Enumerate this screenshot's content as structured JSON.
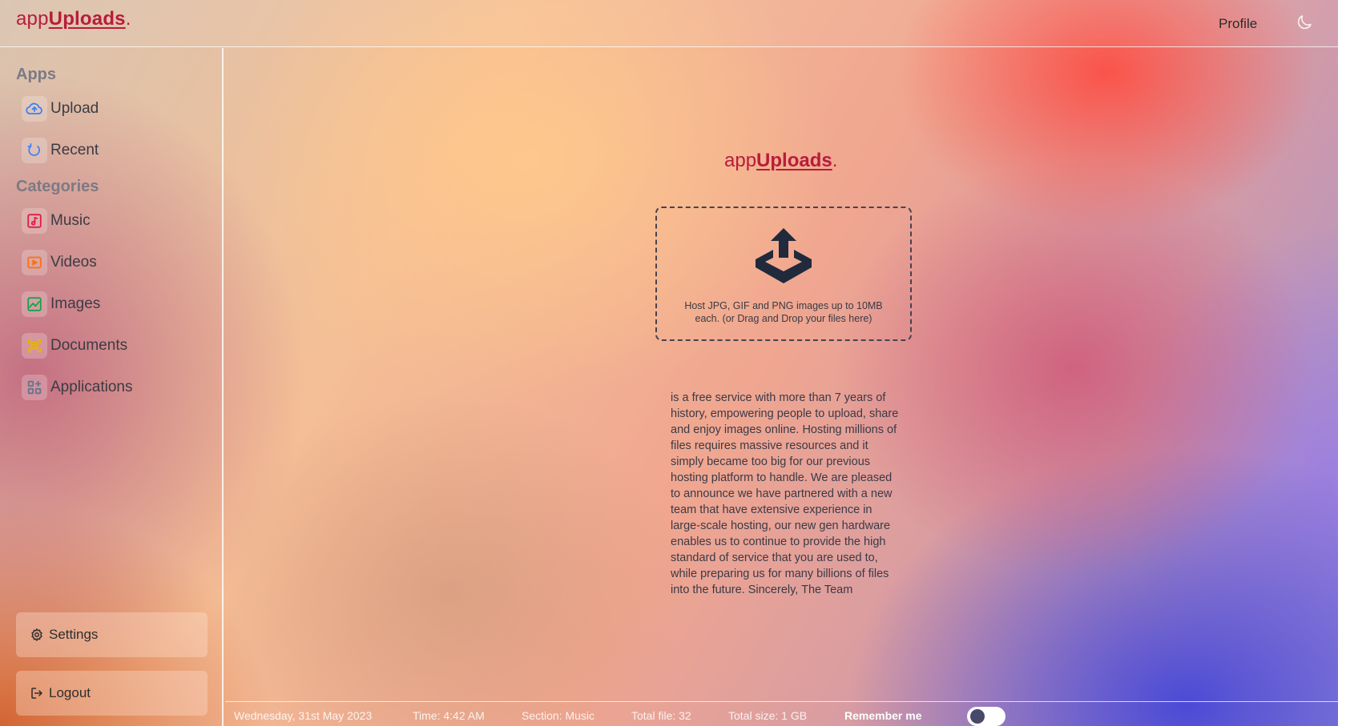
{
  "header": {
    "logo_prefix": "app",
    "logo_strong": "Uploads",
    "logo_suffix": ".",
    "profile_label": "Profile",
    "theme_icon": "moon-icon"
  },
  "sidebar": {
    "apps_heading": "Apps",
    "apps": [
      {
        "label": "Upload",
        "icon": "cloud-upload-icon",
        "color": "#3b82f6"
      },
      {
        "label": "Recent",
        "icon": "refresh-icon",
        "color": "#3b82f6"
      }
    ],
    "categories_heading": "Categories",
    "categories": [
      {
        "label": "Music",
        "icon": "music-icon",
        "color": "#e11d48"
      },
      {
        "label": "Videos",
        "icon": "video-icon",
        "color": "#f97316"
      },
      {
        "label": "Images",
        "icon": "image-icon",
        "color": "#16a34a"
      },
      {
        "label": "Documents",
        "icon": "document-icon",
        "color": "#eab308"
      },
      {
        "label": "Applications",
        "icon": "apps-grid-icon",
        "color": "#64748b"
      }
    ],
    "settings_label": "Settings",
    "logout_label": "Logout"
  },
  "main": {
    "logo_prefix": "app",
    "logo_strong": "Uploads",
    "logo_suffix": ".",
    "dropzone_text": "Host JPG, GIF and PNG images up to 10MB each. (or Drag and Drop your files here)",
    "about_text": "is a free service with more than 7 years of history, empowering people to upload, share and enjoy images online. Hosting millions of files requires massive resources and it simply became too big for our previous hosting platform to handle. We are pleased to announce we have partnered with a new team that have extensive experience in large-scale hosting, our new gen hardware enables us to continue to provide the high standard of service that you are used to, while preparing us for many billions of files into the future. Sincerely, The Team"
  },
  "footer": {
    "date": "Wednesday, 31st May 2023",
    "time": "Time: 4:42 AM",
    "section": "Section: Music",
    "total_files": "Total file: 32",
    "total_size": "Total size: 1 GB",
    "remember_label": "Remember me",
    "remember_on": false
  },
  "colors": {
    "brand": "#b81c3b",
    "toggle_knob": "#48496a"
  }
}
